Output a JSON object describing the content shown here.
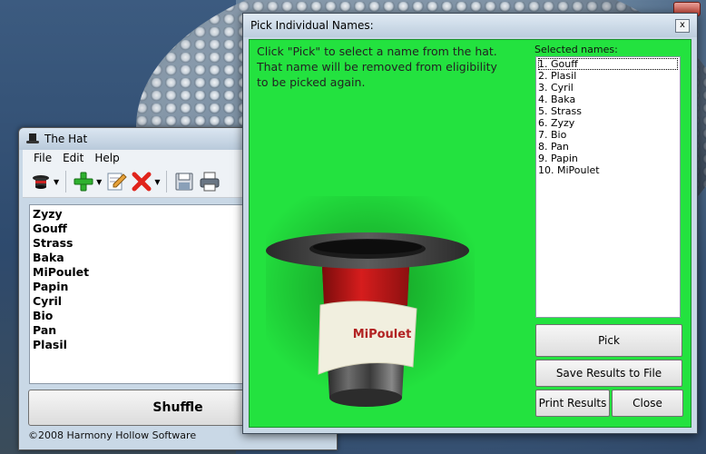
{
  "main_window": {
    "title": "The Hat",
    "menu": [
      "File",
      "Edit",
      "Help"
    ],
    "names": [
      "Zyzy",
      "Gouff",
      "Strass",
      "Baka",
      "MiPoulet",
      "Papin",
      "Cyril",
      "Bio",
      "Pan",
      "Plasil"
    ],
    "shuffle_label": "Shuffle",
    "status_text": "©2008 Harmony Hollow Software"
  },
  "pick_dialog": {
    "title": "Pick Individual Names:",
    "close_glyph": "x",
    "instruction": "Click \"Pick\" to select a name from the hat. That name will be removed from eligibility to be picked again.",
    "selected_label": "Selected names:",
    "selected_names": [
      "1. Gouff",
      "2. Plasil",
      "3. Cyril",
      "4. Baka",
      "5. Strass",
      "6. Zyzy",
      "7. Bio",
      "8. Pan",
      "9. Papin",
      "10. MiPoulet"
    ],
    "picked_name": "MiPoulet",
    "buttons": {
      "pick": "Pick",
      "save": "Save Results to File",
      "print": "Print Results",
      "close": "Close"
    },
    "background_color": "#23e23f"
  },
  "icons": [
    "hat-icon",
    "add-icon",
    "edit-icon",
    "delete-icon",
    "save-icon",
    "print-icon"
  ]
}
